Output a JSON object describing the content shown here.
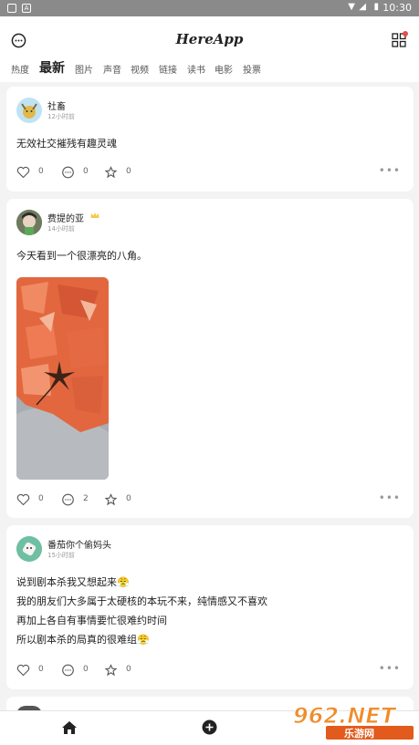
{
  "status_bar": {
    "time": "10:30"
  },
  "header": {
    "app_title": "HereApp"
  },
  "tabs": [
    "热度",
    "最新",
    "图片",
    "声音",
    "视频",
    "链接",
    "读书",
    "电影",
    "投票"
  ],
  "active_tab": "最新",
  "posts": [
    {
      "user": "社畜",
      "time": "12小时前",
      "lines": [
        "无效社交摧残有趣灵魂"
      ],
      "likes": "0",
      "comments": "0",
      "favorites": "0"
    },
    {
      "user": "费提的亚",
      "time": "14小时前",
      "lines": [
        "今天看到一个很漂亮的八角。"
      ],
      "likes": "0",
      "comments": "2",
      "favorites": "0"
    },
    {
      "user": "番茄你个偷妈头",
      "time": "15小时前",
      "lines": [
        "说到剧本杀我又想起来😤",
        "我的朋友们大多属于太硬核的本玩不来，纯情感又不喜欢",
        "再加上各自有事情要忙很难约时间",
        "所以剧本杀的局真的很难组😤"
      ],
      "likes": "0",
      "comments": "0",
      "favorites": "0"
    }
  ],
  "watermark": {
    "text": "962.NET",
    "subtext": "乐游网"
  },
  "colors": {
    "accent": "#e84b4b",
    "background": "#f3f3f3"
  }
}
